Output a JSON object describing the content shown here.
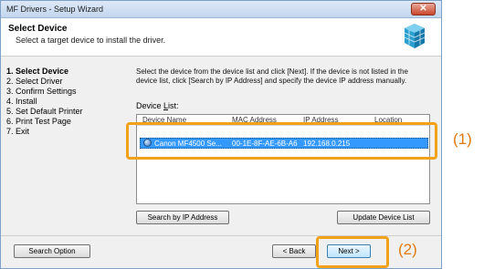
{
  "window": {
    "title": "MF Drivers - Setup Wizard",
    "close_glyph": "✕"
  },
  "header": {
    "title": "Select Device",
    "subtitle": "Select a target device to install the driver."
  },
  "steps": [
    {
      "label": "1.  Select Device",
      "active": true
    },
    {
      "label": "2.  Select Driver",
      "active": false
    },
    {
      "label": "3.  Confirm Settings",
      "active": false
    },
    {
      "label": "4.  Install",
      "active": false
    },
    {
      "label": "5.  Set Default Printer",
      "active": false
    },
    {
      "label": "6.  Print Test Page",
      "active": false
    },
    {
      "label": "7.  Exit",
      "active": false
    }
  ],
  "instructions": "Select the device from the device list and click [Next]. If the device is not listed in the device list, click [Search by IP Address] and specify the device IP address manually.",
  "device_list": {
    "label": "Device List:",
    "columns": [
      "Device Name",
      "MAC Address",
      "IP Address",
      "Location"
    ],
    "rows": [
      {
        "device_name": "Canon MF4500 Se...",
        "mac": "00-1E-8F-AE-6B-A6",
        "ip": "192.168.0.215",
        "location": "",
        "selected": true
      }
    ]
  },
  "buttons": {
    "search_ip": "Search by IP Address",
    "update_list": "Update Device List",
    "search_option": "Search Option",
    "back": "< Back",
    "next": "Next >"
  },
  "callouts": {
    "one": "(1)",
    "two": "(2)"
  },
  "colors": {
    "highlight": "#f2a118",
    "callout_text": "#e07a10",
    "selection": "#3399ff"
  }
}
